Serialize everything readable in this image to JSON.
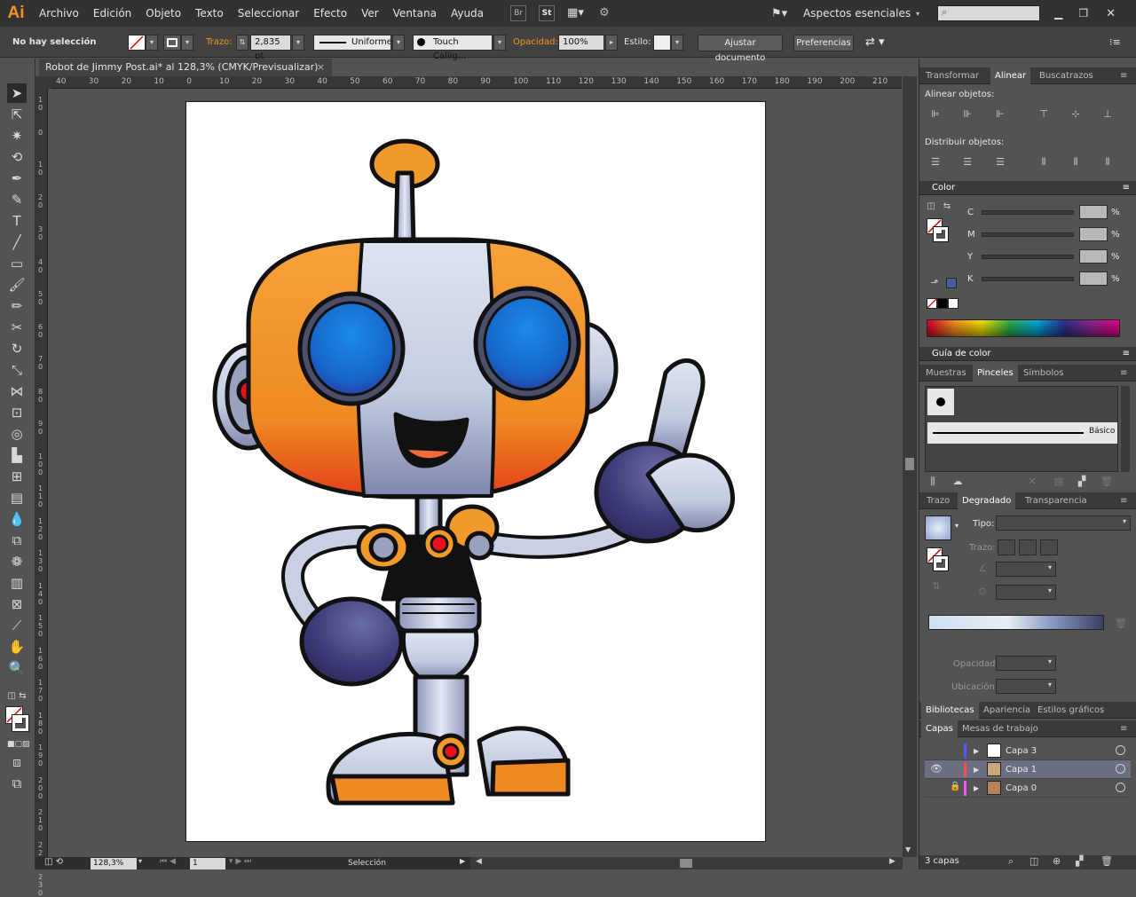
{
  "app": {
    "logo": "Ai",
    "menu": [
      "Archivo",
      "Edición",
      "Objeto",
      "Texto",
      "Seleccionar",
      "Efecto",
      "Ver",
      "Ventana",
      "Ayuda"
    ],
    "bridge_label": "Br",
    "stock_label": "St",
    "workspace": "Aspectos esenciales",
    "search_placeholder": ""
  },
  "control_bar": {
    "selection": "No hay selección",
    "stroke_label": "Trazo:",
    "stroke_value": "2,835 pt",
    "profile": "Uniforme",
    "brush": "Touch Callig...",
    "opacity_label": "Opacidad:",
    "opacity_value": "100%",
    "style_label": "Estilo:",
    "doc_setup": "Ajustar documento",
    "preferences": "Preferencias"
  },
  "document": {
    "tab_title": "Robot de Jimmy Post.ai* al 128,3% (CMYK/Previsualizar)",
    "close": "×",
    "ruler_h": [
      "40",
      "30",
      "20",
      "10",
      "0",
      "10",
      "20",
      "30",
      "40",
      "50",
      "60",
      "70",
      "80",
      "90",
      "100",
      "110",
      "120",
      "130",
      "140",
      "150",
      "160",
      "170",
      "180",
      "190",
      "200",
      "210",
      "22"
    ],
    "ruler_v": [
      "1 0",
      "0",
      "1 0",
      "2 0",
      "3 0",
      "4 0",
      "5 0",
      "6 0",
      "7 0",
      "8 0",
      "9 0",
      "1 0 0",
      "1 1 0",
      "1 2 0",
      "1 3 0",
      "1 4 0",
      "1 5 0",
      "1 6 0",
      "1 7 0",
      "1 8 0",
      "1 9 0",
      "2 0 0",
      "2 1 0",
      "2 2 0",
      "2 3 0"
    ]
  },
  "status_bar": {
    "zoom": "128,3%",
    "page": "1",
    "tool": "Selección"
  },
  "panels": {
    "align_tabs": [
      "Transformar",
      "Alinear",
      "Buscatrazos"
    ],
    "align_objects": "Alinear objetos:",
    "distribute_objects": "Distribuir objetos:",
    "color_title": "Color",
    "cmyk_labels": [
      "C",
      "M",
      "Y",
      "K"
    ],
    "percent": "%",
    "color_guide": "Guía de color",
    "brush_tabs": [
      "Muestras",
      "Pinceles",
      "Símbolos"
    ],
    "brush_basic": "Básico",
    "gradient_tabs": [
      "Trazo",
      "Degradado",
      "Transparencia"
    ],
    "gradient_type": "Tipo:",
    "gradient_stroke": "Trazo:",
    "gradient_opacity": "Opacidad:",
    "gradient_location": "Ubicación:",
    "lib_tabs": [
      "Bibliotecas",
      "Apariencia",
      "Estilos gráficos"
    ],
    "layer_tabs": [
      "Capas",
      "Mesas de trabajo"
    ],
    "layers": [
      {
        "name": "Capa 3",
        "color": "#4a5cff"
      },
      {
        "name": "Capa 1",
        "color": "#ff4d4d"
      },
      {
        "name": "Capa 0",
        "color": "#ff4dff"
      }
    ],
    "layer_count": "3 capas"
  },
  "colors": {
    "accent_orange": "#f7931e",
    "robot_orange": "#ef9a2a",
    "robot_blue": "#1a6fd6",
    "robot_navy": "#3b3a7a",
    "robot_silver": "#c9cfe0"
  }
}
